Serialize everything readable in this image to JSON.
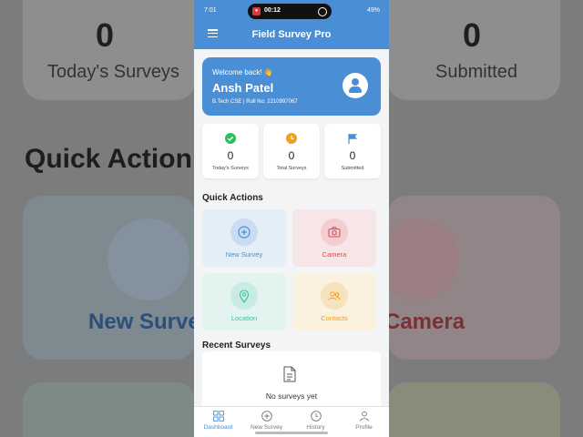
{
  "background_mirror": {
    "stat_left": {
      "value": "0",
      "label": "Today's Surveys"
    },
    "stat_right": {
      "value": "0",
      "label": "Submitted"
    },
    "quick_actions": "Quick Action",
    "tile_left": "New Survey",
    "tile_right": "Camera"
  },
  "status_bar": {
    "time": "7:01",
    "recording_time": "00:12",
    "battery": "49%"
  },
  "app_bar": {
    "title": "Field Survey Pro",
    "menu_icon": "hamburger-icon"
  },
  "welcome": {
    "greeting": "Welcome back! 👋",
    "name": "Ansh Patel",
    "details": "B.Tech CSE | Roll No: 2210997067"
  },
  "stats": [
    {
      "value": "0",
      "label": "Today's Surveys",
      "icon": "check-circle-icon",
      "color": "#2fbf5a"
    },
    {
      "value": "0",
      "label": "Total Surveys",
      "icon": "clock-icon",
      "color": "#f0a020"
    },
    {
      "value": "0",
      "label": "Submitted",
      "icon": "flag-icon",
      "color": "#4a8fd6"
    }
  ],
  "quick_actions": {
    "title": "Quick Actions",
    "tiles": [
      {
        "label": "New Survey",
        "icon": "plus-circle-icon",
        "bg": "#e3eef6",
        "circle": "#c9dcf1",
        "color": "#4a8fd6"
      },
      {
        "label": "Camera",
        "icon": "camera-icon",
        "bg": "#f7e6e8",
        "circle": "#f3cdd2",
        "color": "#d94b58"
      },
      {
        "label": "Location",
        "icon": "location-pin-icon",
        "bg": "#e3f3ef",
        "circle": "#c8ebe2",
        "color": "#38c3a2"
      },
      {
        "label": "Contacts",
        "icon": "contacts-icon",
        "bg": "#faf1df",
        "circle": "#f6e2bd",
        "color": "#f0a020"
      }
    ]
  },
  "recent_surveys": {
    "title": "Recent Surveys",
    "empty_text": "No surveys yet"
  },
  "bottom_nav": [
    {
      "label": "Dashboard",
      "icon": "grid-icon",
      "active": true
    },
    {
      "label": "New Survey",
      "icon": "plus-circle-icon",
      "active": false
    },
    {
      "label": "History",
      "icon": "clock-icon",
      "active": false
    },
    {
      "label": "Profile",
      "icon": "person-icon",
      "active": false
    }
  ]
}
